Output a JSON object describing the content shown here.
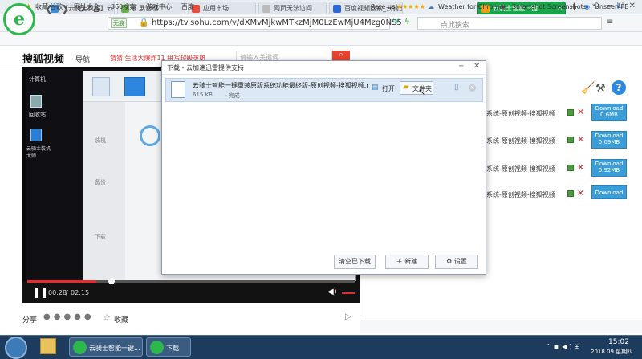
{
  "browser": {
    "tabs": [
      {
        "label": "【云骑士教程】云骑",
        "active": false
      },
      {
        "label": "扩展管理",
        "active": false
      },
      {
        "label": "应用市场",
        "active": false
      },
      {
        "label": "网页无法访问",
        "active": false
      },
      {
        "label": "百度视频搜索_云骑士",
        "active": false
      },
      {
        "label": "云骑士智能一键",
        "active": true
      }
    ],
    "new_tab": "+",
    "address": {
      "secure_label": "无痕",
      "url": "https://tv.sohu.com/v/dXMvMjkwMTkzMjM0LzEwMjU4Mzg0NS5"
    },
    "search_placeholder": "点此搜索",
    "bookmarks": [
      "收藏",
      "谷歌",
      "网址大全",
      "360搜索",
      "游戏中心",
      "百度"
    ]
  },
  "sohu": {
    "logo": "搜狐视频",
    "nav": "导航",
    "ticker": "猜猜  生活大爆炸11  拼写超级英雄",
    "search_placeholder": "请输入关键词"
  },
  "video": {
    "time_current": "00:28",
    "time_total": "02:15",
    "progress": 0.21,
    "desktop_icons": [
      "计算机",
      "回收站",
      "云骑士装机大师"
    ],
    "inner_left_items": [
      "装机",
      "备份",
      "下载"
    ]
  },
  "share": {
    "label": "分享",
    "collect": "收藏"
  },
  "download_list": {
    "rows": [
      {
        "text": "系统-原创视频-搜狐视频",
        "button": "Download\n0.6MB"
      },
      {
        "text": "系统-原创视频-搜狐视频",
        "button": "Download\n0.09MB"
      },
      {
        "text": "系统-原创视频-搜狐视频",
        "button": "Download\n0.92MB"
      },
      {
        "text": "系统-原创视频-搜狐视频",
        "button": "Download"
      }
    ]
  },
  "extensions": [
    {
      "label": "Rate us!",
      "stars": "★★★★★"
    },
    {
      "label": "Weather for Chrome"
    },
    {
      "label": "Smartshot Screenshots"
    },
    {
      "label": "Unseen FB"
    }
  ],
  "dialog": {
    "title": "下载 - 云加速迅雷提供支持",
    "item_name": "云骑士智能一键重装原版系统功能最终版-原创视频-搜狐视频.m...",
    "item_size": "615 KB",
    "item_status": "- 完成",
    "open_label": "打开",
    "folder_label": "文件夹",
    "clear_button": "清空已下载",
    "new_button": "新建",
    "settings_button": "设置"
  },
  "taskbar": {
    "items": [
      "云骑士智能一键...",
      "下载"
    ],
    "time": "15:02",
    "date": "2018.09.星期四"
  }
}
